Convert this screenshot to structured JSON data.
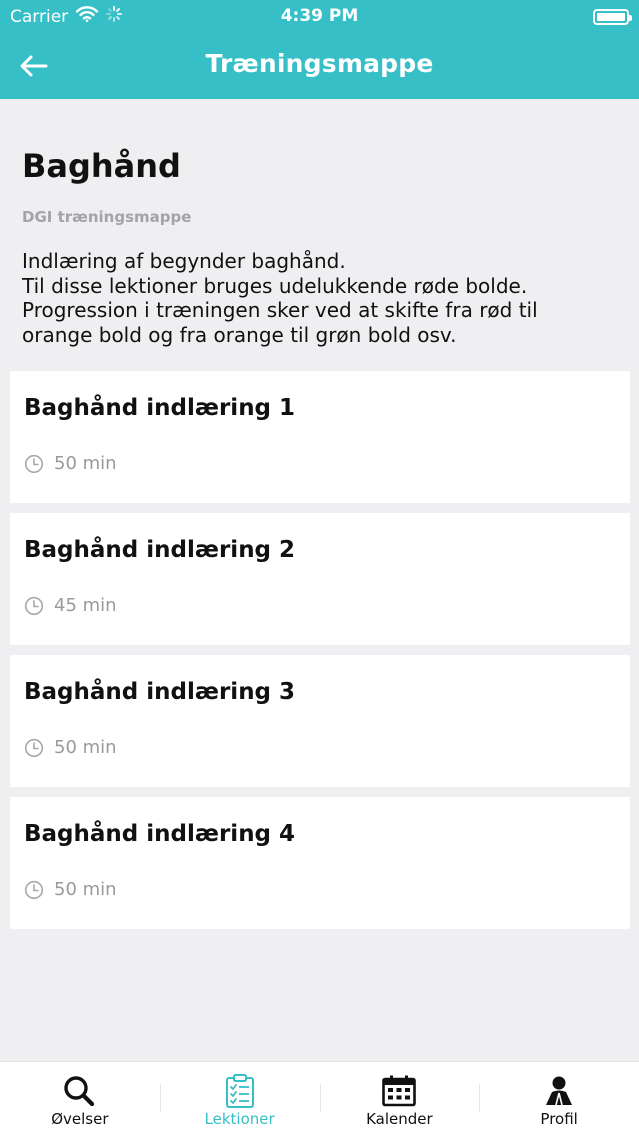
{
  "status_bar": {
    "carrier": "Carrier",
    "time": "4:39 PM"
  },
  "nav": {
    "title": "Træningsmappe",
    "back_icon": "arrow-left-icon"
  },
  "intro": {
    "title": "Baghånd",
    "subtitle": "DGI træningsmappe",
    "description_lines": [
      "Indlæring af begynder baghånd.",
      "Til disse lektioner bruges udelukkende røde bolde.",
      "Progression i træningen sker ved at skifte fra rød til",
      "orange bold og fra orange til grøn bold osv."
    ]
  },
  "lessons": [
    {
      "title": "Baghånd indlæring 1",
      "duration": "50 min"
    },
    {
      "title": "Baghånd indlæring 2",
      "duration": "45 min"
    },
    {
      "title": "Baghånd indlæring 3",
      "duration": "50 min"
    },
    {
      "title": "Baghånd indlæring 4",
      "duration": "50 min"
    }
  ],
  "tabs": [
    {
      "label": "Øvelser",
      "icon": "search-icon",
      "active": false
    },
    {
      "label": "Lektioner",
      "icon": "clipboard-check-icon",
      "active": true
    },
    {
      "label": "Kalender",
      "icon": "calendar-icon",
      "active": false
    },
    {
      "label": "Profil",
      "icon": "person-icon",
      "active": false
    }
  ],
  "colors": {
    "accent": "#36bfc7",
    "background": "#efeff1",
    "card": "#ffffff",
    "muted_text": "#9a9a9e"
  }
}
